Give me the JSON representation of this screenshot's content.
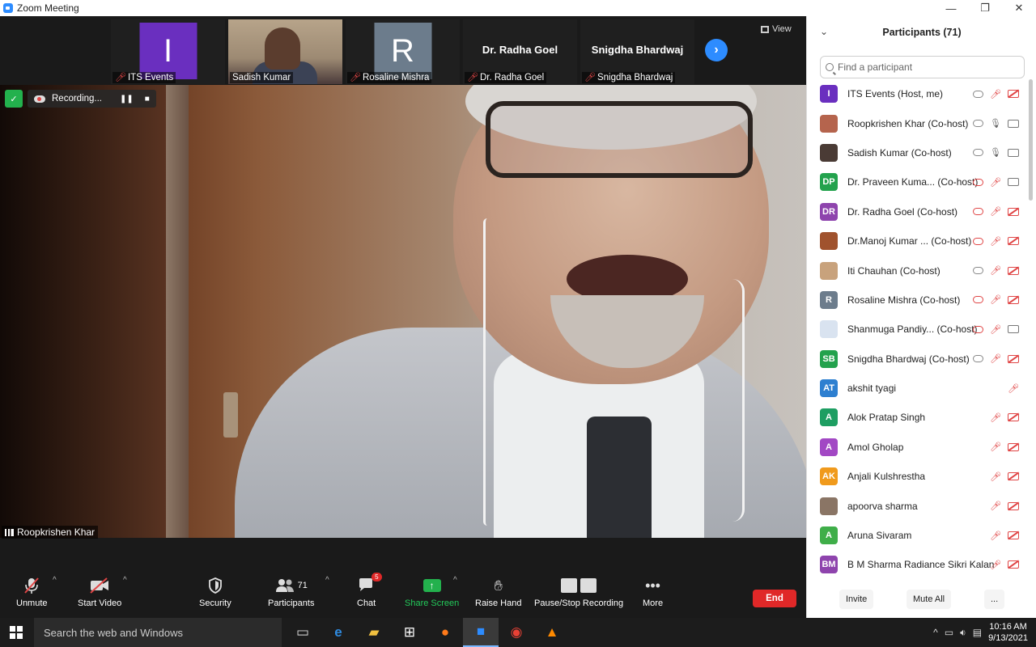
{
  "window": {
    "title": "Zoom Meeting",
    "controls": [
      "—",
      "❐",
      "✕"
    ]
  },
  "thumbnails": [
    {
      "name": "ITS Events",
      "type": "avatar",
      "initial": "I",
      "color": "#6a2fbf"
    },
    {
      "name": "Sadish Kumar",
      "type": "camera"
    },
    {
      "name": "Rosaline Mishra",
      "type": "avatar",
      "initial": "R",
      "color": "#6c7c8c"
    },
    {
      "name": "Dr. Radha Goel",
      "type": "name",
      "display": "Dr. Radha Goel"
    },
    {
      "name": "Snigdha Bhardwaj",
      "type": "name",
      "display": "Snigdha Bhardwaj"
    }
  ],
  "view_label": "View",
  "recording": {
    "label": "Recording..."
  },
  "active_speaker": "Roopkrishen Khar",
  "toolbar": {
    "unmute": "Unmute",
    "start_video": "Start Video",
    "security": "Security",
    "participants": "Participants",
    "participants_count": "71",
    "chat": "Chat",
    "chat_badge": "5",
    "share_screen": "Share Screen",
    "raise_hand": "Raise Hand",
    "pause_stop": "Pause/Stop Recording",
    "more": "More",
    "end": "End"
  },
  "panel": {
    "title": "Participants (71)",
    "search_placeholder": "Find a participant",
    "participants": [
      {
        "name": "ITS Events (Host, me)",
        "initials": "I",
        "color": "#6a2fbf",
        "cloud": true,
        "rec": false,
        "mic": "off",
        "video": "off"
      },
      {
        "name": "Roopkrishen Khar (Co-host)",
        "initials": "",
        "color": "#b5644d",
        "cloud": true,
        "rec": false,
        "mic": "on",
        "video": "on"
      },
      {
        "name": "Sadish Kumar (Co-host)",
        "initials": "",
        "color": "#4a3b35",
        "cloud": true,
        "rec": false,
        "mic": "on",
        "video": "on"
      },
      {
        "name": "Dr. Praveen Kuma... (Co-host)",
        "initials": "DP",
        "color": "#23a24d",
        "cloud": true,
        "rec": true,
        "mic": "off",
        "video": "on"
      },
      {
        "name": "Dr. Radha Goel (Co-host)",
        "initials": "DR",
        "color": "#8e44ad",
        "cloud": true,
        "rec": true,
        "mic": "off",
        "video": "off"
      },
      {
        "name": "Dr.Manoj Kumar ...  (Co-host)",
        "initials": "",
        "color": "#a0522d",
        "cloud": true,
        "rec": true,
        "mic": "off",
        "video": "off"
      },
      {
        "name": "Iti Chauhan (Co-host)",
        "initials": "",
        "color": "#c8a27c",
        "cloud": true,
        "rec": false,
        "mic": "off",
        "video": "off"
      },
      {
        "name": "Rosaline Mishra (Co-host)",
        "initials": "R",
        "color": "#6c7c8c",
        "cloud": true,
        "rec": true,
        "mic": "off",
        "video": "off"
      },
      {
        "name": "Shanmuga Pandiy... (Co-host)",
        "initials": "",
        "color": "#d9e3f0",
        "cloud": true,
        "rec": true,
        "mic": "off",
        "video": "on"
      },
      {
        "name": "Snigdha Bhardwaj (Co-host)",
        "initials": "SB",
        "color": "#23a24d",
        "cloud": true,
        "rec": false,
        "mic": "off",
        "video": "off"
      },
      {
        "name": "akshit tyagi",
        "initials": "AT",
        "color": "#2d7fd0",
        "cloud": false,
        "rec": false,
        "mic": "off",
        "video": "none"
      },
      {
        "name": "Alok Pratap Singh",
        "initials": "A",
        "color": "#1e9e62",
        "cloud": false,
        "rec": false,
        "mic": "off",
        "video": "off"
      },
      {
        "name": "Amol Gholap",
        "initials": "A",
        "color": "#a248c4",
        "cloud": false,
        "rec": false,
        "mic": "off",
        "video": "off"
      },
      {
        "name": "Anjali Kulshrestha",
        "initials": "AK",
        "color": "#f09a1c",
        "cloud": false,
        "rec": false,
        "mic": "off",
        "video": "off"
      },
      {
        "name": "apoorva sharma",
        "initials": "",
        "color": "#8a7565",
        "cloud": false,
        "rec": false,
        "mic": "off",
        "video": "off"
      },
      {
        "name": "Aruna Sivaram",
        "initials": "A",
        "color": "#3fae49",
        "cloud": false,
        "rec": false,
        "mic": "off",
        "video": "off"
      },
      {
        "name": "B M Sharma Radiance Sikri Kalan",
        "initials": "BM",
        "color": "#8e44ad",
        "cloud": false,
        "rec": false,
        "mic": "off",
        "video": "off"
      }
    ],
    "footer": {
      "invite": "Invite",
      "mute_all": "Mute All",
      "more": "..."
    }
  },
  "taskbar": {
    "search_text": "Search the web and Windows",
    "time": "10:16 AM",
    "date": "9/13/2021"
  }
}
